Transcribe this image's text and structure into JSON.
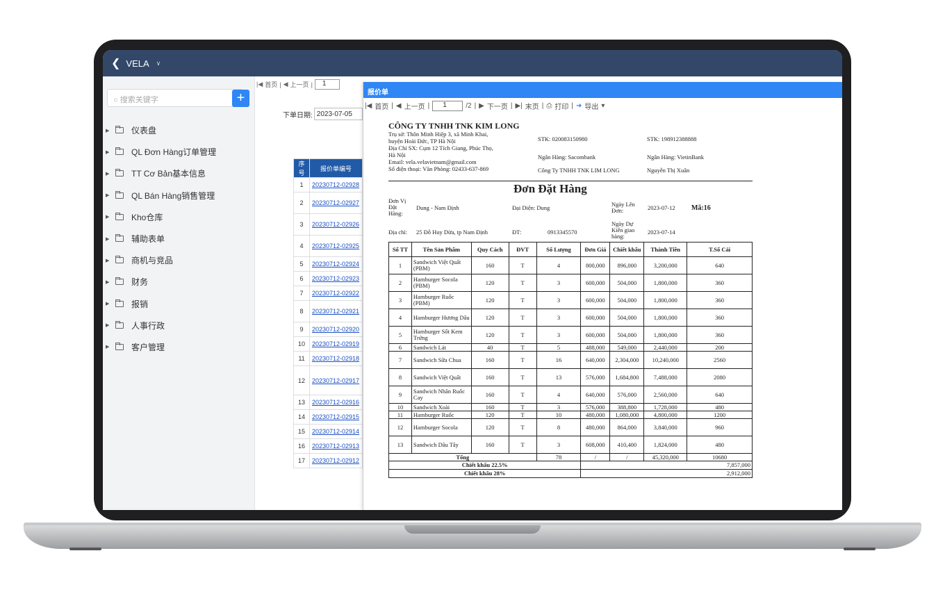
{
  "app": {
    "name": "VELA"
  },
  "sidebar": {
    "search_placeholder": "搜索关键字",
    "items": [
      {
        "label": "仪表盘"
      },
      {
        "label": "QL Đơn Hàng订单管理"
      },
      {
        "label": "TT Cơ Bản基本信息"
      },
      {
        "label": "QL Bán Hàng销售管理"
      },
      {
        "label": "Kho仓库"
      },
      {
        "label": "辅助表单"
      },
      {
        "label": "商机与竞品"
      },
      {
        "label": "财务"
      },
      {
        "label": "报销"
      },
      {
        "label": "人事行政"
      },
      {
        "label": "客户管理"
      }
    ]
  },
  "main": {
    "pager": {
      "first": "首页",
      "prev": "上一页",
      "page": "1"
    },
    "date_label": "下单日期:",
    "date_value": "2023-07-05",
    "list_headers": {
      "no": "序号",
      "code": "报价单编号"
    },
    "list": [
      {
        "no": "1",
        "code": "20230712-02928"
      },
      {
        "no": "2",
        "code": "20230712-02927"
      },
      {
        "no": "3",
        "code": "20230712-02926"
      },
      {
        "no": "4",
        "code": "20230712-02925"
      },
      {
        "no": "5",
        "code": "20230712-02924"
      },
      {
        "no": "6",
        "code": "20230712-02923"
      },
      {
        "no": "7",
        "code": "20230712-02922"
      },
      {
        "no": "8",
        "code": "20230712-02921"
      },
      {
        "no": "9",
        "code": "20230712-02920"
      },
      {
        "no": "10",
        "code": "20230712-02919"
      },
      {
        "no": "11",
        "code": "20230712-02918"
      },
      {
        "no": "12",
        "code": "20230712-02917"
      },
      {
        "no": "13",
        "code": "20230712-02916"
      },
      {
        "no": "14",
        "code": "20230712-02915"
      },
      {
        "no": "15",
        "code": "20230712-02914"
      },
      {
        "no": "16",
        "code": "20230712-02913"
      },
      {
        "no": "17",
        "code": "20230712-02912"
      }
    ]
  },
  "dialog": {
    "title": "报价单",
    "toolbar": {
      "first": "首页",
      "prev": "上一页",
      "page": "1",
      "total": "/2",
      "next": "下一页",
      "last": "末页",
      "print": "打印",
      "export": "导出"
    },
    "company": {
      "name": "CÔNG TY TNHH TNK KIM LONG",
      "address1": "Trụ sở: Thôn Minh Hiệp 3, xã Minh Khai,",
      "address2": "huyện Hoài Đức, TP Hà Nội",
      "factory1": "Địa Chỉ SX: Cụm 12 Tích Giang, Phúc Thọ,",
      "factory2": "Hà Nội",
      "email": "Email: vela.velavietnam@gmail.com",
      "phone": "Số điện thoại: Văn Phòng: 02433-637-869",
      "stk1": "STK: 020083150980",
      "bank1": "Ngân Hàng: Sacombank",
      "owner1": "Công Ty TNHH TNK LIM LONG",
      "stk2": "STK: 198912388888",
      "bank2": "Ngân Hàng: VietinBank",
      "owner2": "Nguyễn Thị Xuân"
    },
    "order": {
      "title": "Đơn Đặt Hàng",
      "unit_label1": "Đơn Vị",
      "unit_label2": "Đặt",
      "unit_label3": "Hàng:",
      "unit_value": "Dung - Nam Định",
      "rep": "Đại Diện: Dung",
      "date_label1": "Ngày Lên",
      "date_label2": "Đơn:",
      "date_value": "2023-07-12",
      "code": "Mã:16",
      "addr_label": "Địa chỉ:",
      "addr_value": "25 Đỗ Huy Dừa, tp Nam Định",
      "tel_label": "ĐT:",
      "tel_value": "0913345570",
      "deliv_label1": "Ngày Dự",
      "deliv_label2": "Kiến giao",
      "deliv_label3": "hàng:",
      "deliv_value": "2023-07-14"
    },
    "table": {
      "headers": [
        "Số TT",
        "Tên Sản Phẩm",
        "Quy Cách",
        "ĐVT",
        "Số Lượng",
        "Đơn Giá",
        "Chiết khấu",
        "Thành Tiền",
        "T.Số Cái"
      ],
      "rows": [
        [
          "1",
          "Sandwich Việt Quất (PBM)",
          "160",
          "T",
          "4",
          "800,000",
          "896,000",
          "3,200,000",
          "640"
        ],
        [
          "2",
          "Hamburger Socola (PBM)",
          "120",
          "T",
          "3",
          "600,000",
          "504,000",
          "1,800,000",
          "360"
        ],
        [
          "3",
          "Hamburger Ruốc (PBM)",
          "120",
          "T",
          "3",
          "600,000",
          "504,000",
          "1,800,000",
          "360"
        ],
        [
          "4",
          "Hamburger Hương Dâu",
          "120",
          "T",
          "3",
          "600,000",
          "504,000",
          "1,800,000",
          "360"
        ],
        [
          "5",
          "Hamburger Sốt Kem Trứng",
          "120",
          "T",
          "3",
          "600,000",
          "504,000",
          "1,800,000",
          "360"
        ],
        [
          "6",
          "Sandwich Lát",
          "40",
          "T",
          "5",
          "488,000",
          "549,000",
          "2,440,000",
          "200"
        ],
        [
          "7",
          "Sandwich Sữa Chua",
          "160",
          "T",
          "16",
          "640,000",
          "2,304,000",
          "10,240,000",
          "2560"
        ],
        [
          "8",
          "Sandwich Việt Quất",
          "160",
          "T",
          "13",
          "576,000",
          "1,684,800",
          "7,488,000",
          "2080"
        ],
        [
          "9",
          "Sandwich Nhân Ruốc Cay",
          "160",
          "T",
          "4",
          "640,000",
          "576,000",
          "2,560,000",
          "640"
        ],
        [
          "10",
          "Sandwich Xoài",
          "160",
          "T",
          "3",
          "576,000",
          "388,800",
          "1,728,000",
          "480"
        ],
        [
          "11",
          "Hamburger Ruốc",
          "120",
          "T",
          "10",
          "480,000",
          "1,080,000",
          "4,800,000",
          "1200"
        ],
        [
          "12",
          "Hamburger Socola",
          "120",
          "T",
          "8",
          "480,000",
          "864,000",
          "3,840,000",
          "960"
        ],
        [
          "13",
          "Sandwich Dâu Tây",
          "160",
          "T",
          "3",
          "608,000",
          "410,400",
          "1,824,000",
          "480"
        ]
      ],
      "total": {
        "label": "Tổng",
        "qty": "78",
        "price": "/",
        "disc": "/",
        "amount": "45,320,000",
        "count": "10680"
      },
      "disc1": {
        "label": "Chiết khấu 22.5%",
        "value": "7,857,000"
      },
      "disc2": {
        "label": "Chiết khấu 28%",
        "value": "2,912,000"
      }
    }
  }
}
